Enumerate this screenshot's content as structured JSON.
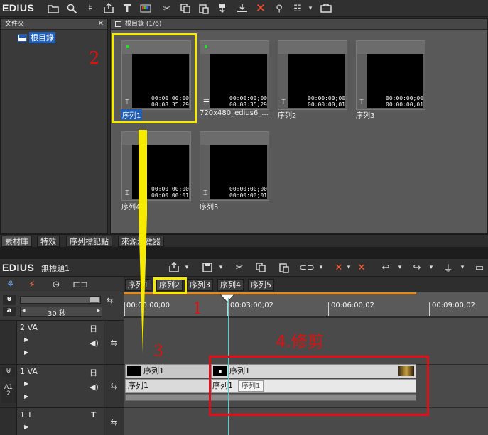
{
  "app": {
    "logo": "EDIUS"
  },
  "folder_panel": {
    "title": "文件夾",
    "close": "✕",
    "root_label": "根目錄"
  },
  "bin_panel": {
    "title": "根目錄 (1/6)",
    "clips": [
      {
        "label": "序列1",
        "tc1": "00:00:00;00",
        "tc2": "00:08:35;29",
        "selected": true
      },
      {
        "label": "720x480_edius6_...",
        "tc1": "00:00:00;00",
        "tc2": "00:08:35;29",
        "selected": false
      },
      {
        "label": "序列2",
        "tc1": "00:00:00;00",
        "tc2": "00:00:00;01",
        "selected": false
      },
      {
        "label": "序列3",
        "tc1": "00:00:00;00",
        "tc2": "00:00:00;01",
        "selected": false
      },
      {
        "label": "序列4",
        "tc1": "00:00:00;00",
        "tc2": "00:00:00;01",
        "selected": false
      },
      {
        "label": "序列5",
        "tc1": "00:00:00;00",
        "tc2": "00:00:00;01",
        "selected": false
      }
    ]
  },
  "bin_tabs": [
    "素材庫",
    "特效",
    "序列標記點",
    "來源瀏覽器"
  ],
  "timeline": {
    "logo": "EDIUS",
    "project_title": "無標題1",
    "zoom_label": "30 秒",
    "seq_tabs": [
      "序列1",
      "序列2",
      "序列3",
      "序列4",
      "序列5"
    ],
    "ruler_labels": [
      "00:00:00;00",
      "00:03:00;02",
      "00:06:00;02",
      "00:09:00;02"
    ],
    "tracks": [
      {
        "name": "2 VA"
      },
      {
        "name": "1 VA"
      },
      {
        "name": "1 T"
      }
    ],
    "clip_v1_a": "序列1",
    "clip_v1_b": "序列1",
    "clip_a1_a": "序列1",
    "clip_a1_b": "序列1",
    "clip_a1_tooltip": "序列1",
    "a1_label": "A",
    "a1_sub": "1",
    "a1_sub2": "2"
  },
  "annotations": {
    "n1": "1",
    "n2": "2",
    "n3": "3",
    "n4": "4.修剪"
  },
  "colors": {
    "annotation_red": "#e01010",
    "annotation_yellow": "#f5ea00",
    "selection_blue": "#1f5fb8"
  }
}
